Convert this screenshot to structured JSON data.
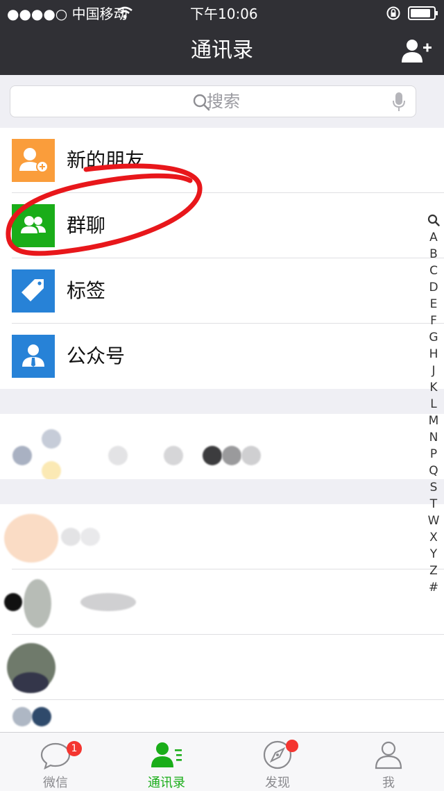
{
  "status_bar": {
    "carrier": "●●●●○ 中国移动",
    "time": "下午10:06"
  },
  "nav": {
    "title": "通讯录"
  },
  "search": {
    "placeholder": "搜索"
  },
  "menu_items": [
    {
      "label": "新的朋友",
      "icon": "add-friend-icon",
      "color": "#fa9d3b"
    },
    {
      "label": "群聊",
      "icon": "group-chat-icon",
      "color": "#1aad19"
    },
    {
      "label": "标签",
      "icon": "tag-icon",
      "color": "#2782d7"
    },
    {
      "label": "公众号",
      "icon": "official-account-icon",
      "color": "#2782d7"
    }
  ],
  "index_letters": [
    "A",
    "B",
    "C",
    "D",
    "E",
    "F",
    "G",
    "H",
    "J",
    "K",
    "L",
    "M",
    "N",
    "P",
    "Q",
    "S",
    "T",
    "W",
    "X",
    "Y",
    "Z",
    "#"
  ],
  "tabs": [
    {
      "label": "微信",
      "icon": "chat-icon",
      "badge": "1",
      "active": false
    },
    {
      "label": "通讯录",
      "icon": "contacts-icon",
      "active": true
    },
    {
      "label": "发现",
      "icon": "discover-icon",
      "dot": true,
      "active": false
    },
    {
      "label": "我",
      "icon": "me-icon",
      "active": false
    }
  ],
  "colors": {
    "bar_bg": "#303035",
    "accent_green": "#1aad19",
    "badge_red": "#f43530",
    "annotation_red": "#e8171b"
  }
}
